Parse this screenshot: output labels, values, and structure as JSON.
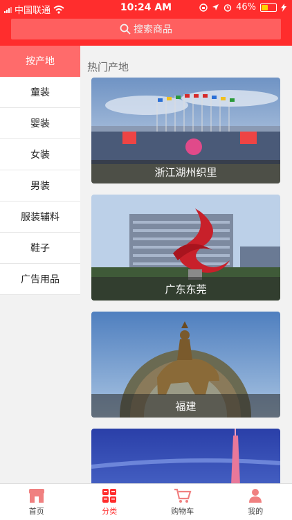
{
  "status_bar": {
    "carrier": "中国联通",
    "time": "10:24 AM",
    "battery_percent": "46%",
    "battery_level": 0.46,
    "icons": [
      "signal-icon",
      "wifi-icon",
      "screen-lock-icon",
      "location-icon",
      "alarm-icon",
      "battery-icon",
      "charging-icon"
    ]
  },
  "search": {
    "placeholder": "搜索商品",
    "icon": "search-icon"
  },
  "sidebar": {
    "items": [
      {
        "label": "按产地",
        "active": true
      },
      {
        "label": "童装"
      },
      {
        "label": "婴装"
      },
      {
        "label": "女装"
      },
      {
        "label": "男装"
      },
      {
        "label": "服装辅料"
      },
      {
        "label": "鞋子"
      },
      {
        "label": "广告用品"
      }
    ]
  },
  "main": {
    "section_title": "热门产地",
    "cards": [
      {
        "label": "浙江湖州织里"
      },
      {
        "label": "广东东莞"
      },
      {
        "label": "福建"
      },
      {
        "label": ""
      }
    ]
  },
  "tabbar": {
    "items": [
      {
        "label": "首页",
        "icon": "store-icon"
      },
      {
        "label": "分类",
        "icon": "category-icon",
        "active": true
      },
      {
        "label": "购物车",
        "icon": "cart-icon"
      },
      {
        "label": "我的",
        "icon": "user-icon"
      }
    ]
  },
  "colors": {
    "brand_red": "#ff2d2d",
    "active_side": "#ff6b6b",
    "search_bg": "#ff5f5f"
  }
}
